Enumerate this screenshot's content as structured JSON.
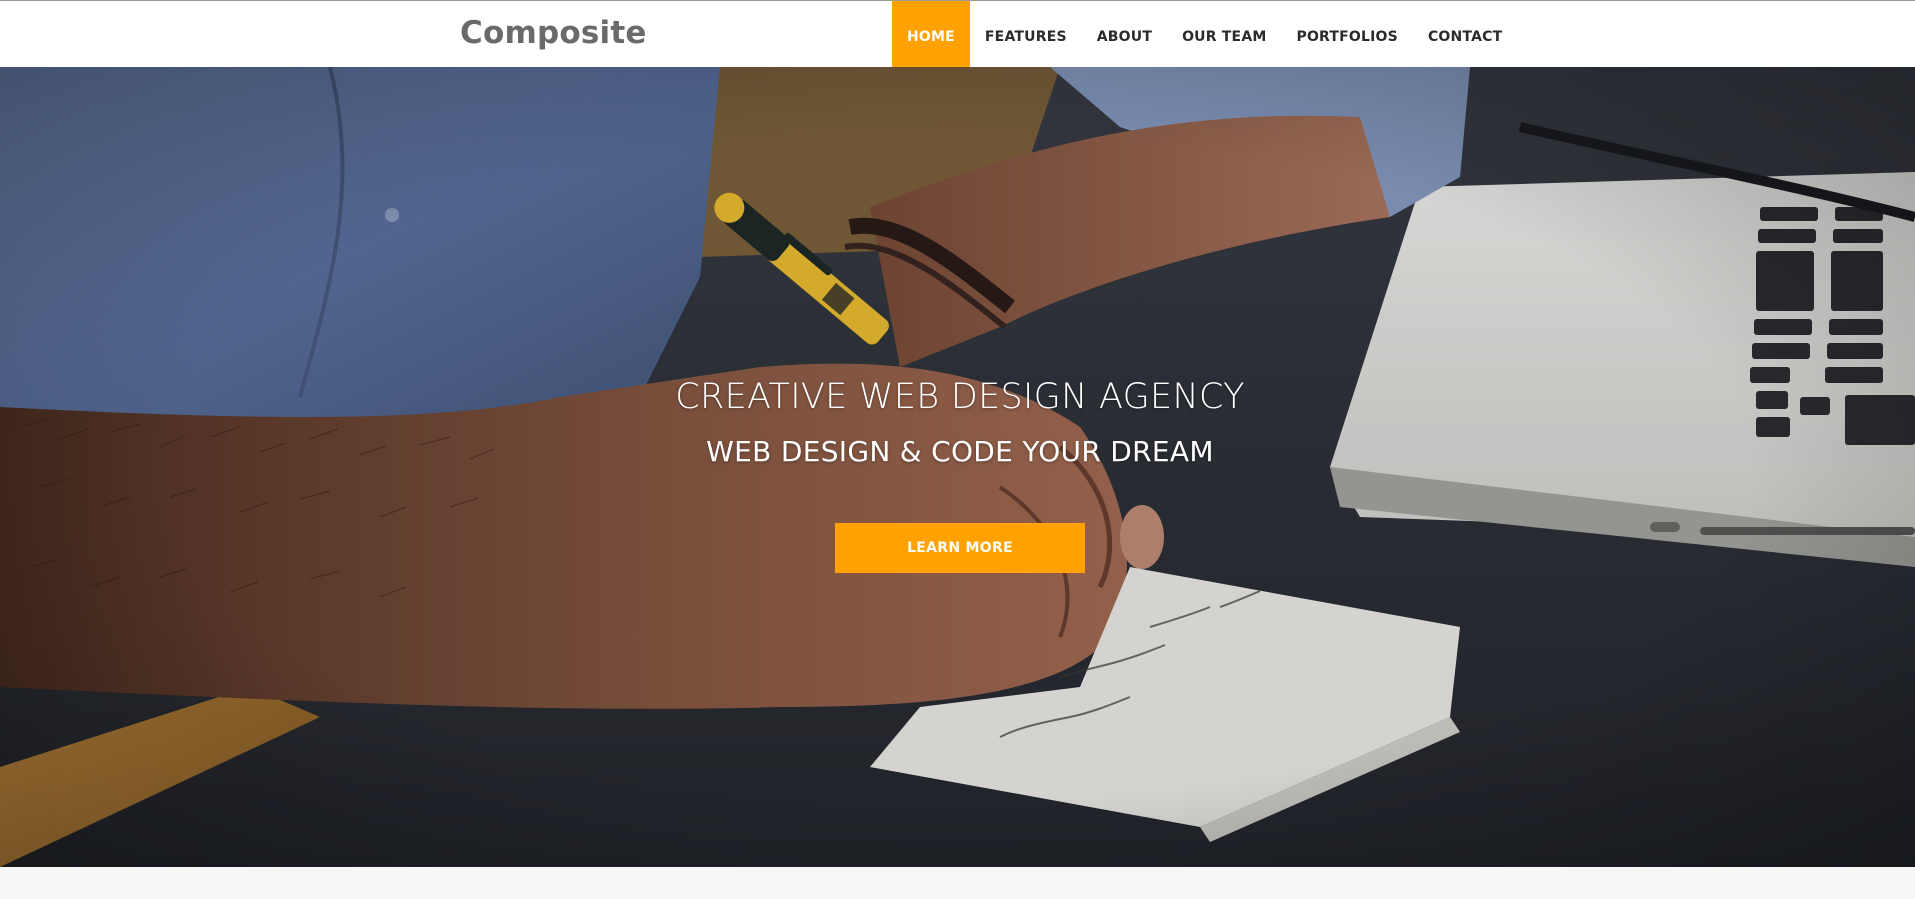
{
  "brand": {
    "name": "Composite"
  },
  "nav": {
    "items": [
      {
        "label": "HOME",
        "active": true
      },
      {
        "label": "FEATURES",
        "active": false
      },
      {
        "label": "ABOUT",
        "active": false
      },
      {
        "label": "OUR TEAM",
        "active": false
      },
      {
        "label": "PORTFOLIOS",
        "active": false
      },
      {
        "label": "CONTACT",
        "active": false
      }
    ]
  },
  "hero": {
    "title": "CREATIVE WEB DESIGN AGENCY",
    "subtitle": "WEB DESIGN & CODE YOUR DREAM",
    "button_label": "LEARN MORE",
    "image": "hero-photo"
  },
  "colors": {
    "accent": "#ffa200",
    "nav_text": "#2b2b2b",
    "logo_text": "#6a6a6a",
    "header_bg": "#ffffff",
    "page_bg": "#f7f7f7"
  }
}
